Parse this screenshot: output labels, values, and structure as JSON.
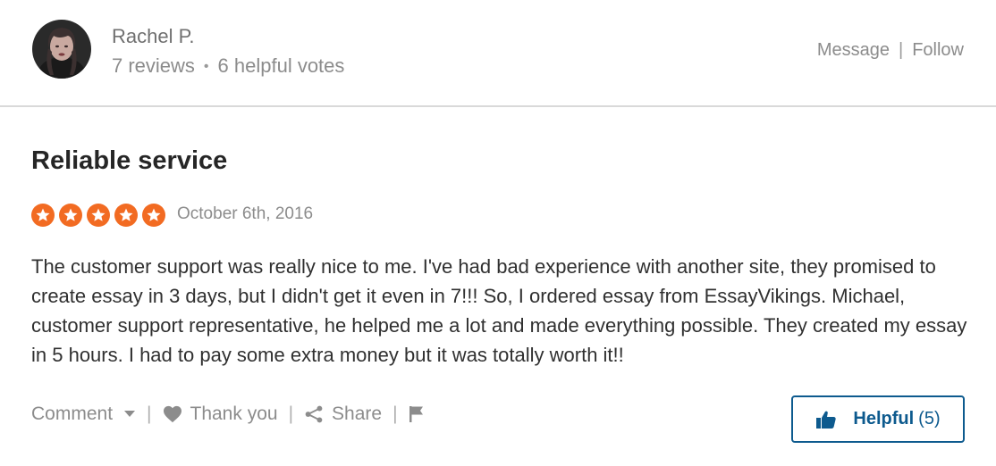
{
  "reviewer": {
    "name": "Rachel P.",
    "reviews": "7 reviews",
    "separator": "•",
    "helpful_votes": "6 helpful votes",
    "avatar_icon": "user-avatar"
  },
  "header_actions": {
    "message": "Message",
    "separator": "|",
    "follow": "Follow"
  },
  "review": {
    "title": "Reliable service",
    "rating": 5,
    "max_rating": 5,
    "date": "October 6th, 2016",
    "body": "The customer support was really nice to me. I've had bad experience with another site, they promised to create essay in 3 days, but I didn't get it even in 7!!! So, I ordered essay from EssayVikings. Michael, customer support representative, he helped me a lot and made everything possible. They created my essay in 5 hours. I had to pay some extra money but it was totally worth it!!"
  },
  "footer": {
    "comment": "Comment",
    "thank_you": "Thank you",
    "share": "Share",
    "separator": "|",
    "helpful_label": "Helpful",
    "helpful_count": "(5)"
  },
  "colors": {
    "star_fill": "#f26b22",
    "helpful_blue": "#0d5a8e",
    "muted_text": "#8c8c8c"
  }
}
